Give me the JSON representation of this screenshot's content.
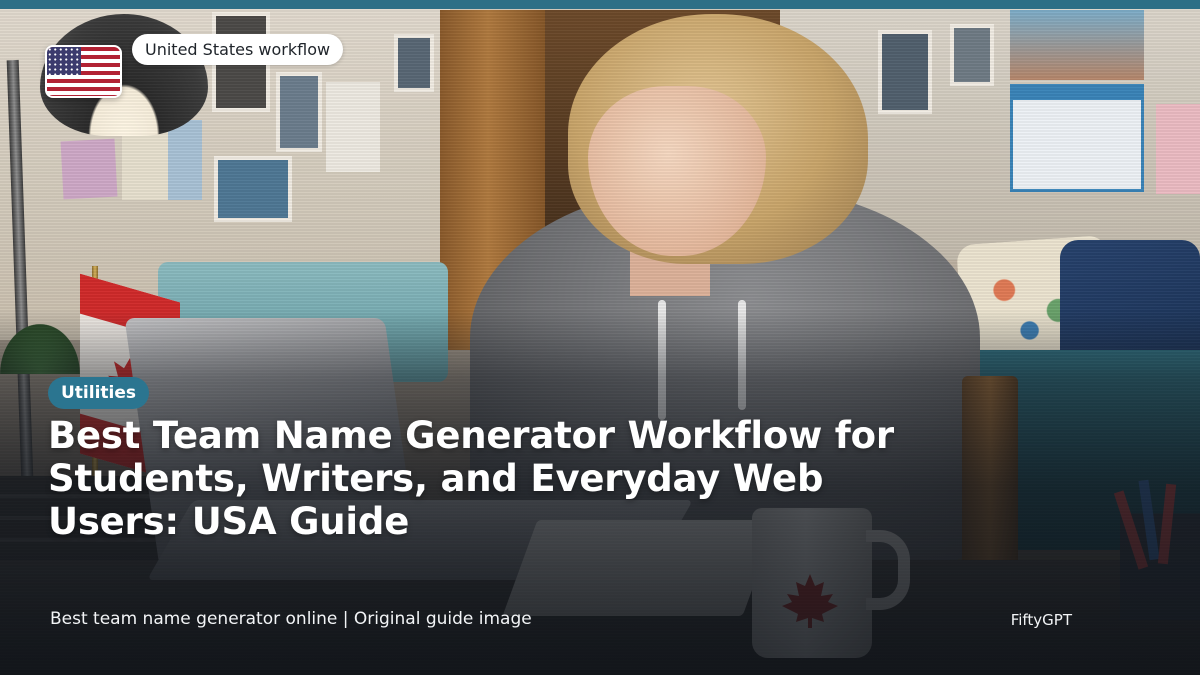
{
  "country": {
    "flag_icon": "us-flag-icon",
    "workflow_label": "United States workflow"
  },
  "article": {
    "category": "Utilities",
    "title": "Best Team Name Generator Workflow for Students, Writers, and Everyday Web Users: USA Guide"
  },
  "footer": {
    "caption": "Best team name generator online | Original guide image",
    "brand": "FiftyGPT"
  },
  "colors": {
    "accent": "#2d6f86",
    "badge": "#2b7590",
    "pill_background": "#ffffff",
    "text_on_image": "#ffffff"
  }
}
